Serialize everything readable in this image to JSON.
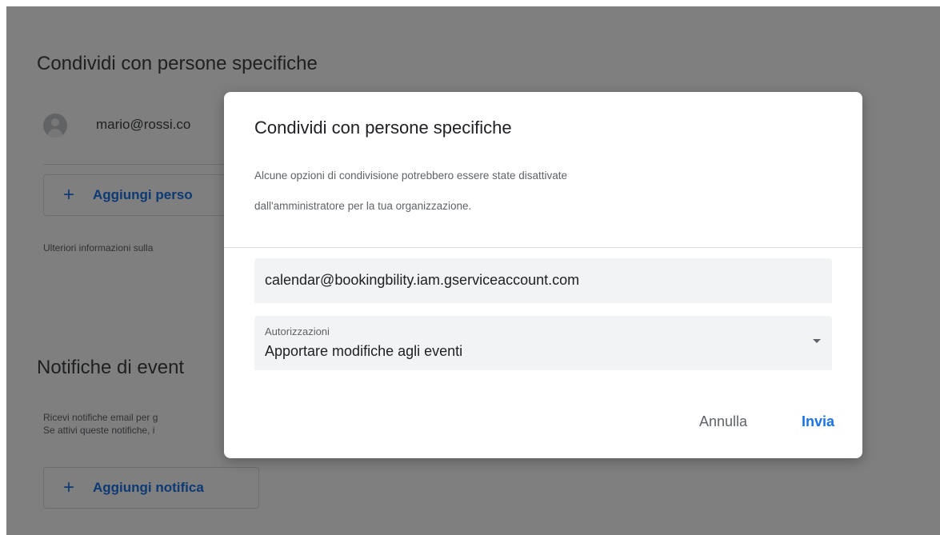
{
  "background": {
    "share_section": {
      "title": "Condividi con persone specifiche",
      "person_email": "mario@rossi.co",
      "add_person_icon": "plus-icon",
      "add_person_label": "Aggiungi perso",
      "info_text": "Ulteriori informazioni sulla"
    },
    "notify_section": {
      "title": "Notifiche di event",
      "desc_line1": "Ricevi notifiche email per g",
      "desc_line2": "Se attivi queste notifiche, i",
      "add_notify_icon": "plus-icon",
      "add_notify_label": "Aggiungi notifica"
    }
  },
  "dialog": {
    "title": "Condividi con persone specifiche",
    "description_line1": "Alcune opzioni di condivisione potrebbero essere state disattivate",
    "description_line2": "dall'amministratore per la tua organizzazione.",
    "email_field": {
      "value": "calendar@bookingbility.iam.gserviceaccount.com"
    },
    "permissions_select": {
      "label": "Autorizzazioni",
      "value": "Apportare modifiche agli eventi",
      "icon": "dropdown-caret-icon"
    },
    "buttons": {
      "cancel": "Annulla",
      "send": "Invia"
    }
  },
  "colors": {
    "accent": "#1a73e8",
    "scrim": "rgba(0,0,0,0.5)",
    "field_bg": "#f1f3f4"
  }
}
